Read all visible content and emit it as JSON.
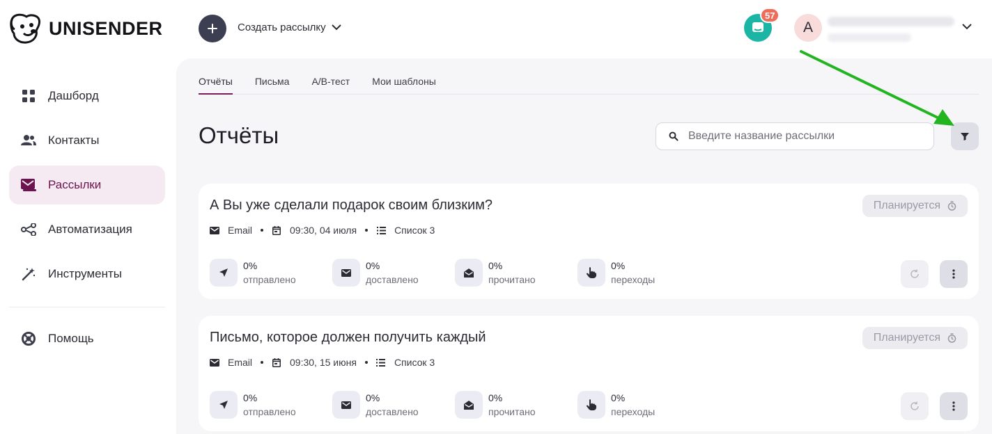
{
  "brand": {
    "name": "UNISENDER"
  },
  "header": {
    "create_label": "Создать рассылку",
    "create_icon": "plus-icon",
    "notifications_count": "57",
    "avatar_letter": "A",
    "support_color": "#1ab5a4"
  },
  "sidebar": {
    "items": [
      {
        "label": "Дашборд",
        "icon": "dashboard-icon"
      },
      {
        "label": "Контакты",
        "icon": "contacts-icon"
      },
      {
        "label": "Рассылки",
        "icon": "mail-icon",
        "active": true
      },
      {
        "label": "Автоматизация",
        "icon": "automation-icon"
      },
      {
        "label": "Инструменты",
        "icon": "magic-wand-icon"
      }
    ],
    "help_label": "Помощь"
  },
  "tabs": [
    {
      "label": "Отчёты",
      "active": true
    },
    {
      "label": "Письма"
    },
    {
      "label": "А/B-тест"
    },
    {
      "label": "Мои шаблоны"
    }
  ],
  "main": {
    "title": "Отчёты",
    "search_placeholder": "Введите название рассылки"
  },
  "campaigns": [
    {
      "title": "А Вы уже сделали подарок своим близким?",
      "status": "Планируется",
      "channel": "Email",
      "datetime": "09:30, 04 июля",
      "list": "Список 3",
      "stats": [
        {
          "value": "0%",
          "label": "отправлено"
        },
        {
          "value": "0%",
          "label": "доставлено"
        },
        {
          "value": "0%",
          "label": "прочитано"
        },
        {
          "value": "0%",
          "label": "переходы"
        }
      ]
    },
    {
      "title": "Письмо, которое должен получить каждый",
      "status": "Планируется",
      "channel": "Email",
      "datetime": "09:30, 15 июня",
      "list": "Список 3",
      "stats": [
        {
          "value": "0%",
          "label": "отправлено"
        },
        {
          "value": "0%",
          "label": "доставлено"
        },
        {
          "value": "0%",
          "label": "прочитано"
        },
        {
          "value": "0%",
          "label": "переходы"
        }
      ]
    }
  ],
  "colors": {
    "accent": "#7a1b5c",
    "annotation_arrow": "#22b51f"
  }
}
